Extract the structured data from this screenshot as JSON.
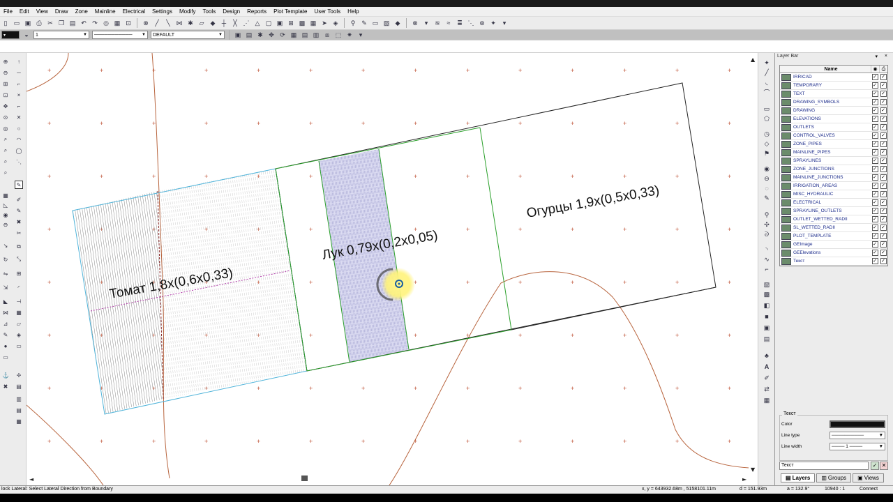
{
  "menu": [
    "File",
    "Edit",
    "View",
    "Draw",
    "Zone",
    "Mainline",
    "Electrical",
    "Settings",
    "Modify",
    "Tools",
    "Design",
    "Reports",
    "Plot Template",
    "User Tools",
    "Help"
  ],
  "toolbar": {
    "line_weight": "1",
    "layer_combo": "DEFAULT"
  },
  "drawing": {
    "label_tomato": "Томат 1,8х(0,6х0,33)",
    "label_onion": "Лук 0,79х(0,2х0,05)",
    "label_cucumber": "Огурцы 1,9х(0,5х0,33)"
  },
  "panel": {
    "title": "Layer Bar",
    "header_name": "Name",
    "layers": [
      {
        "name": "IRRICAD"
      },
      {
        "name": "TEMPORARY"
      },
      {
        "name": "TEXT"
      },
      {
        "name": "DRAWING_SYMBOLS"
      },
      {
        "name": "DRAWING"
      },
      {
        "name": "ELEVATIONS"
      },
      {
        "name": "OUTLETS"
      },
      {
        "name": "CONTROL_VALVES"
      },
      {
        "name": "ZONE_PIPES"
      },
      {
        "name": "MAINLINE_PIPES"
      },
      {
        "name": "SPRAYLINES"
      },
      {
        "name": "ZONE_JUNCTIONS"
      },
      {
        "name": "MAINLINE_JUNCTIONS"
      },
      {
        "name": "IRRIGATION_AREAS"
      },
      {
        "name": "MISC_HYDRAULIC"
      },
      {
        "name": "ELECTRICAL"
      },
      {
        "name": "SPRAYLINE_OUTLETS"
      },
      {
        "name": "OUTLET_WETTED_RADII"
      },
      {
        "name": "SL_WETTED_RADII"
      },
      {
        "name": "PLOT_TEMPLATE"
      },
      {
        "name": "GEImage"
      },
      {
        "name": "GEElevations"
      },
      {
        "name": "Текст"
      }
    ],
    "props_group": "Текст",
    "color_label": "Color",
    "linetype_label": "Line type",
    "linewidth_label": "Line width",
    "linewidth_value": "1",
    "current_layer": "Текст",
    "tabs": [
      "Layers",
      "Groups",
      "Views"
    ]
  },
  "status": {
    "prompt": "lock Lateral: Select Lateral Direction from Boundary",
    "xy": "x, y = 643932.68m , 5158101.11m",
    "d": "d = 151.93m",
    "a": "a = 132.9°",
    "scale": "10940 : 1",
    "connect": "Connect"
  }
}
